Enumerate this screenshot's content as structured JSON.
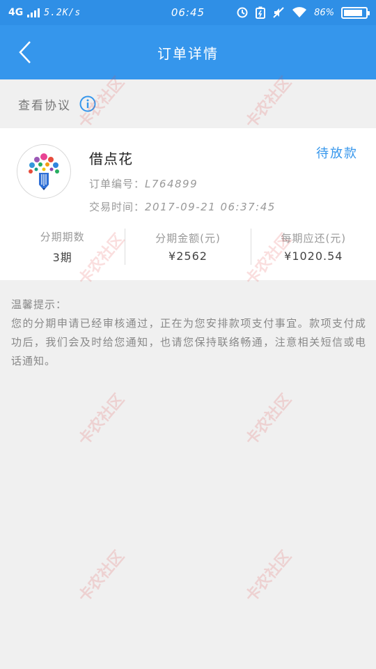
{
  "status_bar": {
    "network": "4G",
    "speed": "5.2K/s",
    "time": "06:45",
    "battery_percent": "86%",
    "battery_level": 0.86,
    "icons": [
      "signal-bars-icon",
      "alarm-icon",
      "battery-saver-icon",
      "mute-icon",
      "wifi-icon",
      "battery-icon"
    ]
  },
  "header": {
    "back_icon": "chevron-left-icon",
    "title": "订单详情"
  },
  "protocol": {
    "label": "查看协议",
    "icon": "info-icon"
  },
  "order": {
    "product_name": "借点花",
    "status": "待放款",
    "order_no_label": "订单编号：",
    "order_no": "L764899",
    "time_label": "交易时间：",
    "time": "2017-09-21 06:37:45",
    "stats": [
      {
        "label": "分期期数",
        "value": "3期"
      },
      {
        "label": "分期金额(元)",
        "value": "¥2562"
      },
      {
        "label": "每期应还(元)",
        "value": "¥1020.54"
      }
    ]
  },
  "tip": {
    "heading": "温馨提示：",
    "body": "您的分期申请已经审核通过，正在为您安排款项支付事宜。款项支付成功后，我们会及时给您通知，也请您保持联络畅通，注意相关短信或电话通知。"
  },
  "watermark": "卡农社区",
  "colors": {
    "status_bar": "#2f8fe6",
    "nav_bar": "#3596ec",
    "accent": "#3596ec",
    "background": "#f0f0f0"
  }
}
